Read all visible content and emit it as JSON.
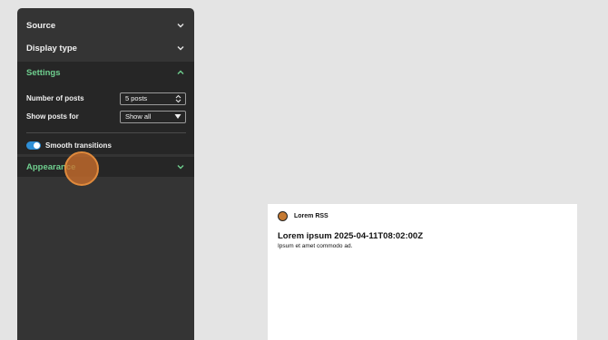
{
  "sidebar": {
    "sections": {
      "source": {
        "label": "Source",
        "expanded": false
      },
      "display_type": {
        "label": "Display type",
        "expanded": false
      },
      "settings": {
        "label": "Settings",
        "expanded": true
      },
      "appearance": {
        "label": "Appearance",
        "expanded": false
      }
    },
    "settings": {
      "number_of_posts": {
        "label": "Number of posts",
        "value": "5 posts"
      },
      "show_posts_for": {
        "label": "Show posts for",
        "value": "Show all"
      },
      "smooth_transitions": {
        "label": "Smooth transitions",
        "enabled": true
      }
    }
  },
  "preview": {
    "feed_name": "Lorem RSS",
    "post": {
      "title": "Lorem ipsum 2025-04-11T08:02:00Z",
      "excerpt": "Ipsum et amet commodo ad."
    }
  },
  "colors": {
    "accent_green": "#6fcf8f",
    "toggle_blue": "#2f8fd6",
    "panel_bg": "#343434",
    "panel_inner_bg": "#262626",
    "click_marker": "#cc6e2c"
  },
  "icons": {
    "section_collapsed": "chevron-down-icon",
    "section_expanded": "chevron-up-icon",
    "stepper": "updown-stepper-icon",
    "dropdown": "caret-down-icon",
    "feed_logo": "rss-feed-logo"
  }
}
